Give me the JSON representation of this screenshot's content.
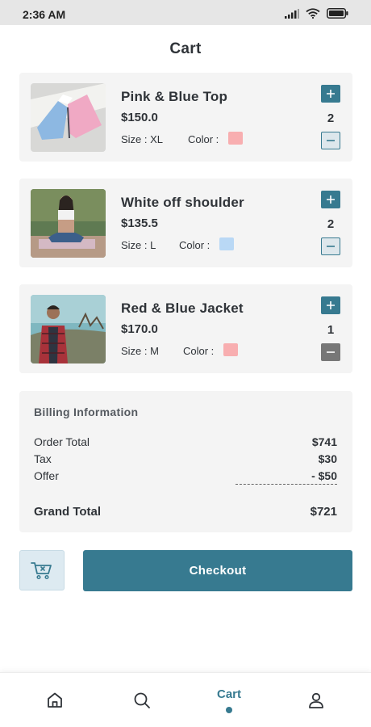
{
  "status": {
    "time": "2:36 AM"
  },
  "title": "Cart",
  "items": [
    {
      "name": "Pink & Blue Top",
      "price": "$150.0",
      "size": "Size : XL",
      "color_label": "Color :",
      "swatch": "#f8aeb0",
      "qty": "2",
      "minus_state": "light"
    },
    {
      "name": "White off shoulder",
      "price": "$135.5",
      "size": "Size : L",
      "color_label": "Color :",
      "swatch": "#b9d8f5",
      "qty": "2",
      "minus_state": "light"
    },
    {
      "name": "Red & Blue Jacket",
      "price": "$170.0",
      "size": "Size : M",
      "color_label": "Color :",
      "swatch": "#f8aeb0",
      "qty": "1",
      "minus_state": "dark"
    }
  ],
  "billing": {
    "title": "Billing Information",
    "rows": [
      {
        "label": "Order Total",
        "value": "$741"
      },
      {
        "label": "Tax",
        "value": "$30"
      },
      {
        "label": "Offer",
        "value": "- $50"
      }
    ],
    "grand": {
      "label": "Grand Total",
      "value": "$721"
    }
  },
  "checkout_label": "Checkout",
  "nav": {
    "active_label": "Cart"
  },
  "colors": {
    "accent": "#377a90",
    "card_bg": "#f4f4f4"
  }
}
